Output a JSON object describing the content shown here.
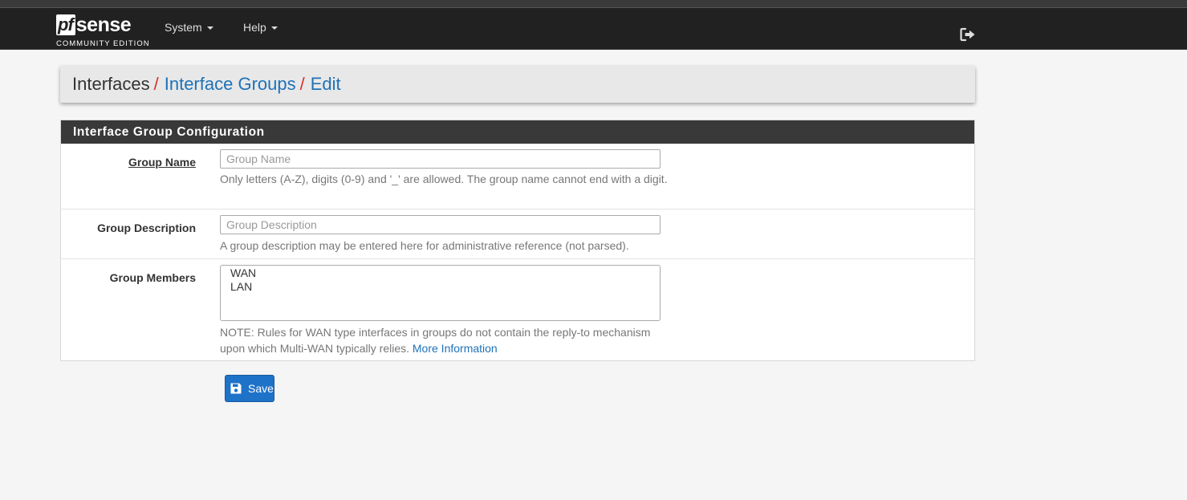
{
  "brand": {
    "logo_pf": "pf",
    "logo_sense": "sense",
    "edition": "COMMUNITY EDITION"
  },
  "nav": {
    "items": [
      {
        "label": "System"
      },
      {
        "label": "Help"
      }
    ],
    "logout_icon": "sign-out-icon"
  },
  "breadcrumb": {
    "items": [
      "Interfaces",
      "Interface Groups",
      "Edit"
    ],
    "separator": "/"
  },
  "panel": {
    "title": "Interface Group Configuration",
    "group_name": {
      "label": "Group Name",
      "placeholder": "Group Name",
      "value": "",
      "help": "Only letters (A-Z), digits (0-9) and '_' are allowed. The group name cannot end with a digit."
    },
    "group_description": {
      "label": "Group Description",
      "placeholder": "Group Description",
      "value": "",
      "help": "A group description may be entered here for administrative reference (not parsed)."
    },
    "group_members": {
      "label": "Group Members",
      "options": [
        "WAN",
        "LAN"
      ],
      "help": "NOTE: Rules for WAN type interfaces in groups do not contain the reply-to mechanism upon which Multi-WAN typically relies.",
      "help_link": "More Information"
    }
  },
  "actions": {
    "save_label": "Save",
    "save_icon": "floppy-disk-icon"
  },
  "colors": {
    "navbar": "#212121",
    "panel_heading": "#393939",
    "link": "#1e72b8",
    "separator": "#d9302c",
    "primary_button": "#1e72c8"
  }
}
